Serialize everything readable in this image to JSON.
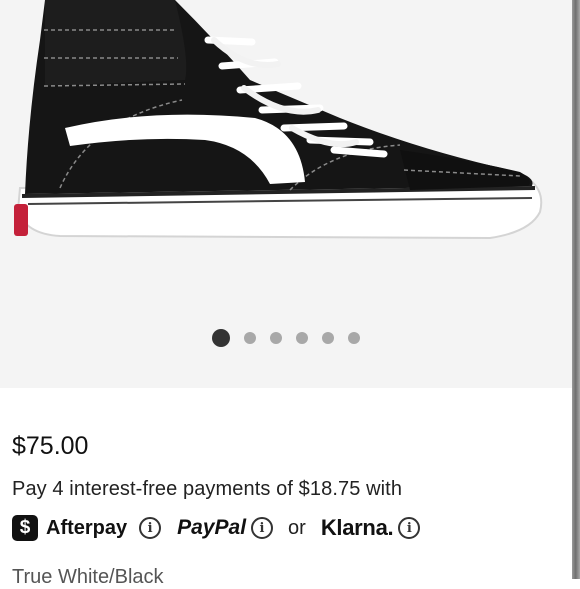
{
  "gallery": {
    "image_alt": "Black and white high-top sneaker",
    "dot_count": 6,
    "active_index": 0
  },
  "product": {
    "price": "$75.00",
    "installment_text": "Pay 4 interest-free payments of $18.75 with",
    "color_name": "True White/Black"
  },
  "payment": {
    "afterpay_badge": "$",
    "afterpay_label": "Afterpay",
    "paypal_label": "PayPal",
    "or_text": "or",
    "klarna_label": "Klarna.",
    "info_glyph": "i"
  },
  "colors": {
    "gallery_bg": "#f4f4f4",
    "dot_active": "#333333",
    "dot_inactive": "#a8a8a8"
  }
}
